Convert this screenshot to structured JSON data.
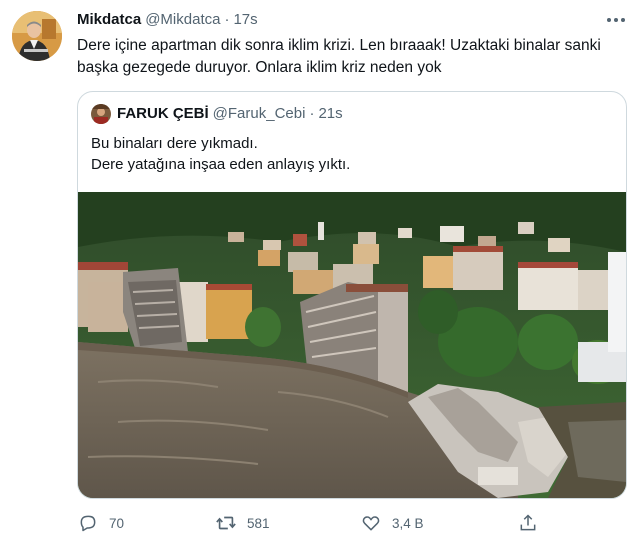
{
  "tweet": {
    "author_name": "Mikdatca",
    "author_handle": "@Mikdatca",
    "separator": "·",
    "time": "17s",
    "text": "Dere içine apartman dik sonra iklim krizi. Len bıraaak! Uzaktaki binalar sanki başka gezegede duruyor. Onlara iklim kriz neden yok"
  },
  "quote": {
    "author_name": "FARUK ÇEBİ",
    "author_handle": "@Faruk_Cebi",
    "separator": "·",
    "time": "21s",
    "lines": [
      "Bu binaları dere yıkmadı.",
      "Dere yatağına inşaa eden anlayış yıktı."
    ]
  },
  "actions": {
    "reply_count": "70",
    "retweet_count": "581",
    "like_count": "3,4 B"
  },
  "icons": {
    "more": "more-icon",
    "reply": "reply-icon",
    "retweet": "retweet-icon",
    "like": "heart-icon",
    "share": "share-icon"
  },
  "colors": {
    "text": "#0f1419",
    "secondary": "#536471",
    "border": "#cfd9de"
  }
}
